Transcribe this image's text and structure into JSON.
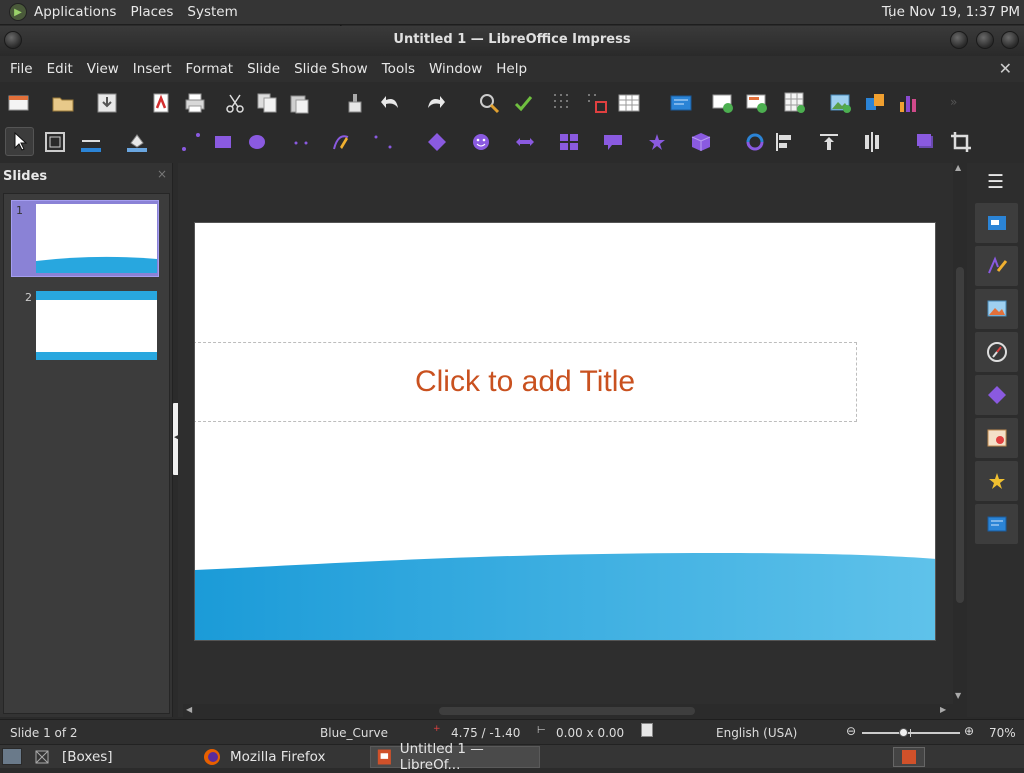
{
  "top_panel": {
    "menus": [
      "Applications",
      "Places",
      "System"
    ],
    "clock": "Tue Nov 19,  1:37 PM"
  },
  "window": {
    "title": "Untitled 1 — LibreOffice Impress"
  },
  "menu_bar": {
    "items": [
      "File",
      "Edit",
      "View",
      "Insert",
      "Format",
      "Slide",
      "Slide Show",
      "Tools",
      "Window",
      "Help"
    ],
    "close_glyph": "✕"
  },
  "slides_pane": {
    "header": "Slides",
    "thumbnails": [
      {
        "number": "1",
        "selected": true
      },
      {
        "number": "2",
        "selected": false
      }
    ]
  },
  "slide": {
    "title_placeholder": "Click to add Title"
  },
  "status_bar": {
    "slide_info": "Slide 1 of 2",
    "master": "Blue_Curve",
    "position": "4.75 / -1.40",
    "size": "0.00 x 0.00",
    "language": "English (USA)",
    "zoom": "70%",
    "zoom_fraction": 0.42
  },
  "taskbar": {
    "tasks": [
      "[Boxes]",
      "Mozilla Firefox",
      "Untitled 1 — LibreOf..."
    ]
  },
  "colors": {
    "accent": "#8a82d6",
    "title_placeholder": "#c9511f",
    "wave": "#28a7df"
  }
}
